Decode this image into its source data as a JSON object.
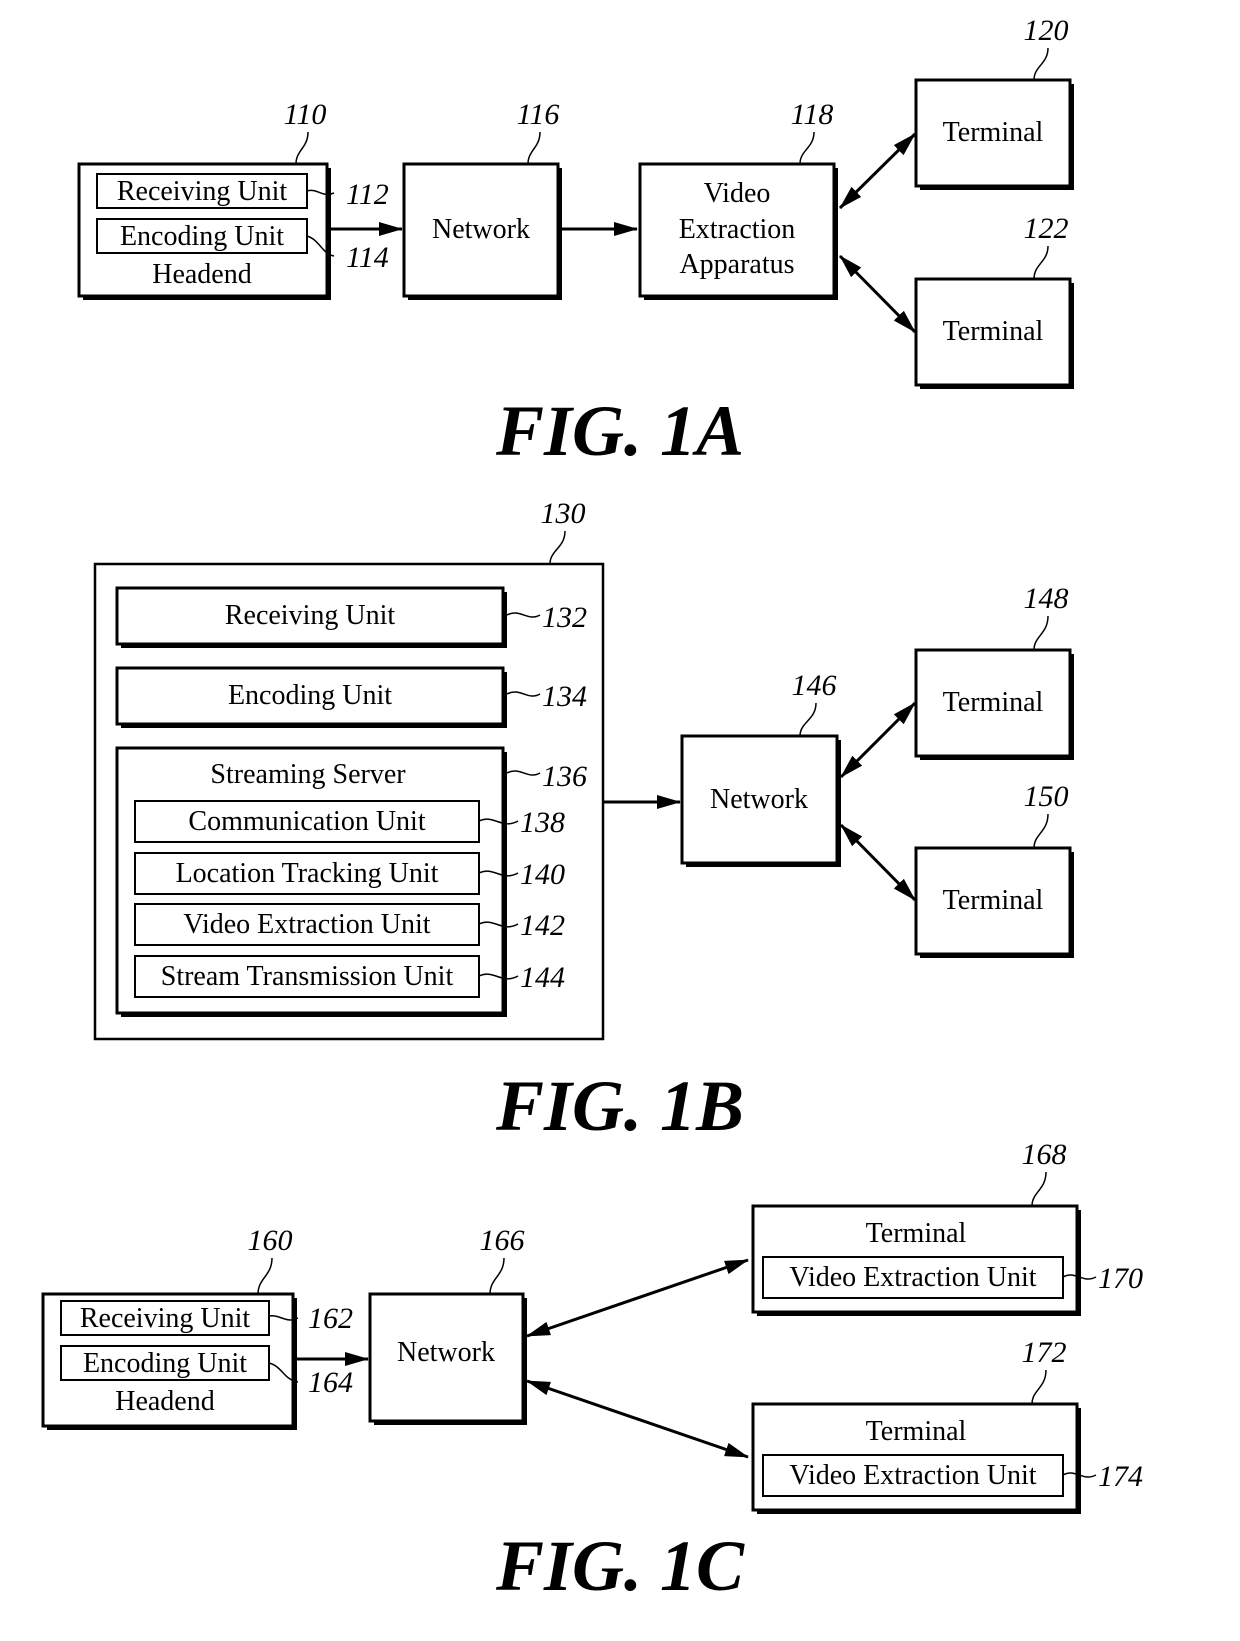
{
  "figures": {
    "fig1a": {
      "caption": "FIG. 1A",
      "headend": {
        "ref": "110",
        "label": "Headend",
        "receiving": {
          "label": "Receiving Unit",
          "ref": "112"
        },
        "encoding": {
          "label": "Encoding Unit",
          "ref": "114"
        }
      },
      "network": {
        "ref": "116",
        "label": "Network"
      },
      "apparatus": {
        "ref": "118",
        "line1": "Video",
        "line2": "Extraction",
        "line3": "Apparatus"
      },
      "terminal1": {
        "ref": "120",
        "label": "Terminal"
      },
      "terminal2": {
        "ref": "122",
        "label": "Terminal"
      }
    },
    "fig1b": {
      "caption": "FIG. 1B",
      "system": {
        "ref": "130"
      },
      "receiving": {
        "label": "Receiving Unit",
        "ref": "132"
      },
      "encoding": {
        "label": "Encoding Unit",
        "ref": "134"
      },
      "server": {
        "label": "Streaming Server",
        "ref": "136",
        "units": [
          {
            "label": "Communication Unit",
            "ref": "138"
          },
          {
            "label": "Location Tracking Unit",
            "ref": "140"
          },
          {
            "label": "Video Extraction Unit",
            "ref": "142"
          },
          {
            "label": "Stream Transmission Unit",
            "ref": "144"
          }
        ]
      },
      "network": {
        "ref": "146",
        "label": "Network"
      },
      "terminal1": {
        "ref": "148",
        "label": "Terminal"
      },
      "terminal2": {
        "ref": "150",
        "label": "Terminal"
      }
    },
    "fig1c": {
      "caption": "FIG. 1C",
      "headend": {
        "ref": "160",
        "label": "Headend",
        "receiving": {
          "label": "Receiving Unit",
          "ref": "162"
        },
        "encoding": {
          "label": "Encoding Unit",
          "ref": "164"
        }
      },
      "network": {
        "ref": "166",
        "label": "Network"
      },
      "terminal1": {
        "ref": "168",
        "label": "Terminal",
        "unit": {
          "label": "Video Extraction Unit",
          "ref": "170"
        }
      },
      "terminal2": {
        "ref": "172",
        "label": "Terminal",
        "unit": {
          "label": "Video Extraction Unit",
          "ref": "174"
        }
      }
    }
  }
}
